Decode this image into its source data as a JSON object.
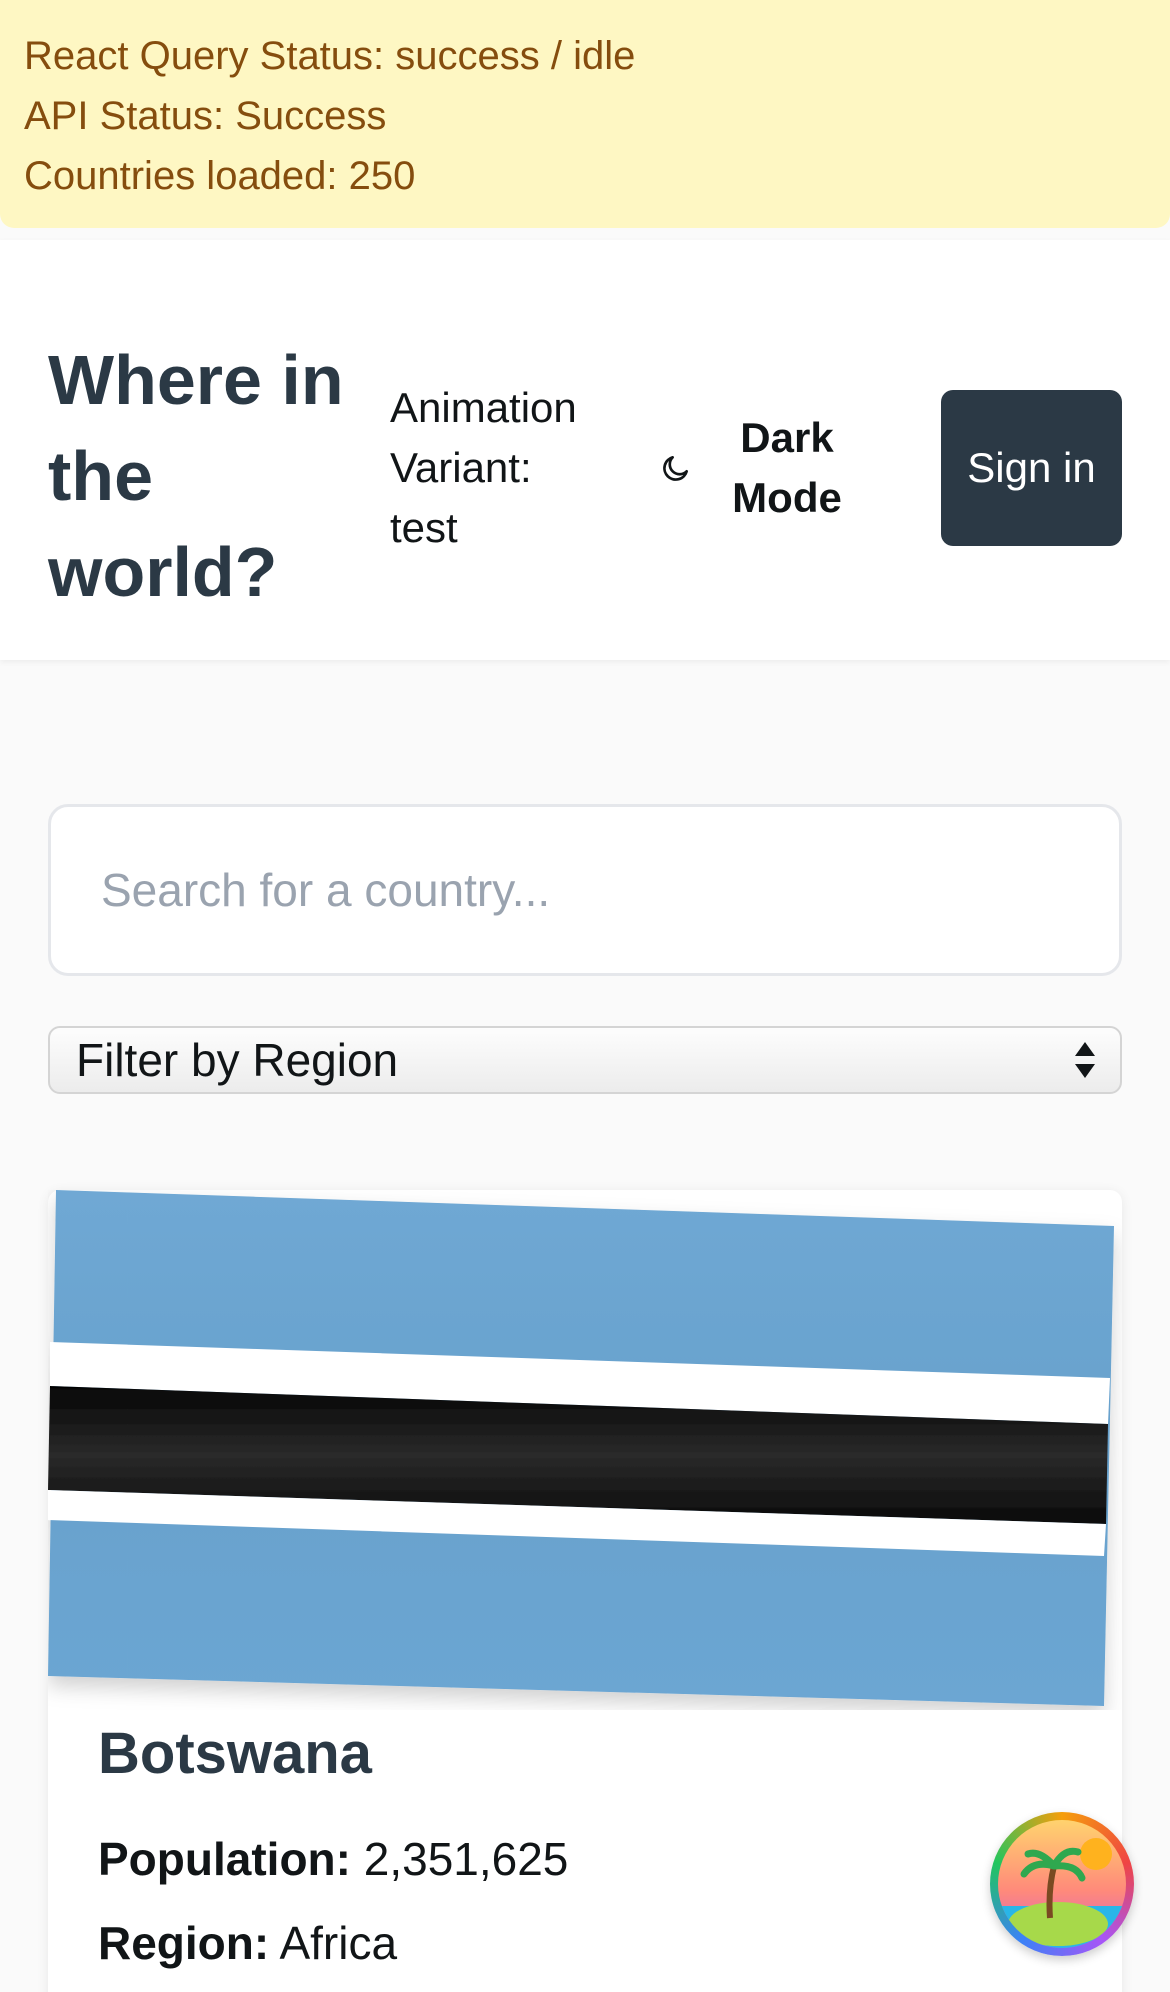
{
  "debug": {
    "query_status": "React Query Status: success / idle",
    "api_status": "API Status: Success",
    "countries_loaded": "Countries loaded: 250"
  },
  "header": {
    "title": "Where in the world?",
    "animation_variant": "Animation Variant: test",
    "dark_mode_label": "Dark Mode",
    "sign_in_label": "Sign in"
  },
  "search": {
    "placeholder": "Search for a country...",
    "value": ""
  },
  "filter": {
    "selected": "Filter by Region"
  },
  "countries": [
    {
      "name": "Botswana",
      "population_label": "Population:",
      "population": "2,351,625",
      "region_label": "Region:",
      "region": "Africa"
    }
  ],
  "colors": {
    "banner_bg": "#fef7c3",
    "banner_text": "#854d0e",
    "primary_dark": "#2b3945",
    "flag_blue": "#6ca6d2",
    "flag_black": "#141414"
  },
  "icons": {
    "dark_mode": "moon-icon",
    "select": "chevron-up-down-icon",
    "fab": "island-avatar-icon"
  }
}
